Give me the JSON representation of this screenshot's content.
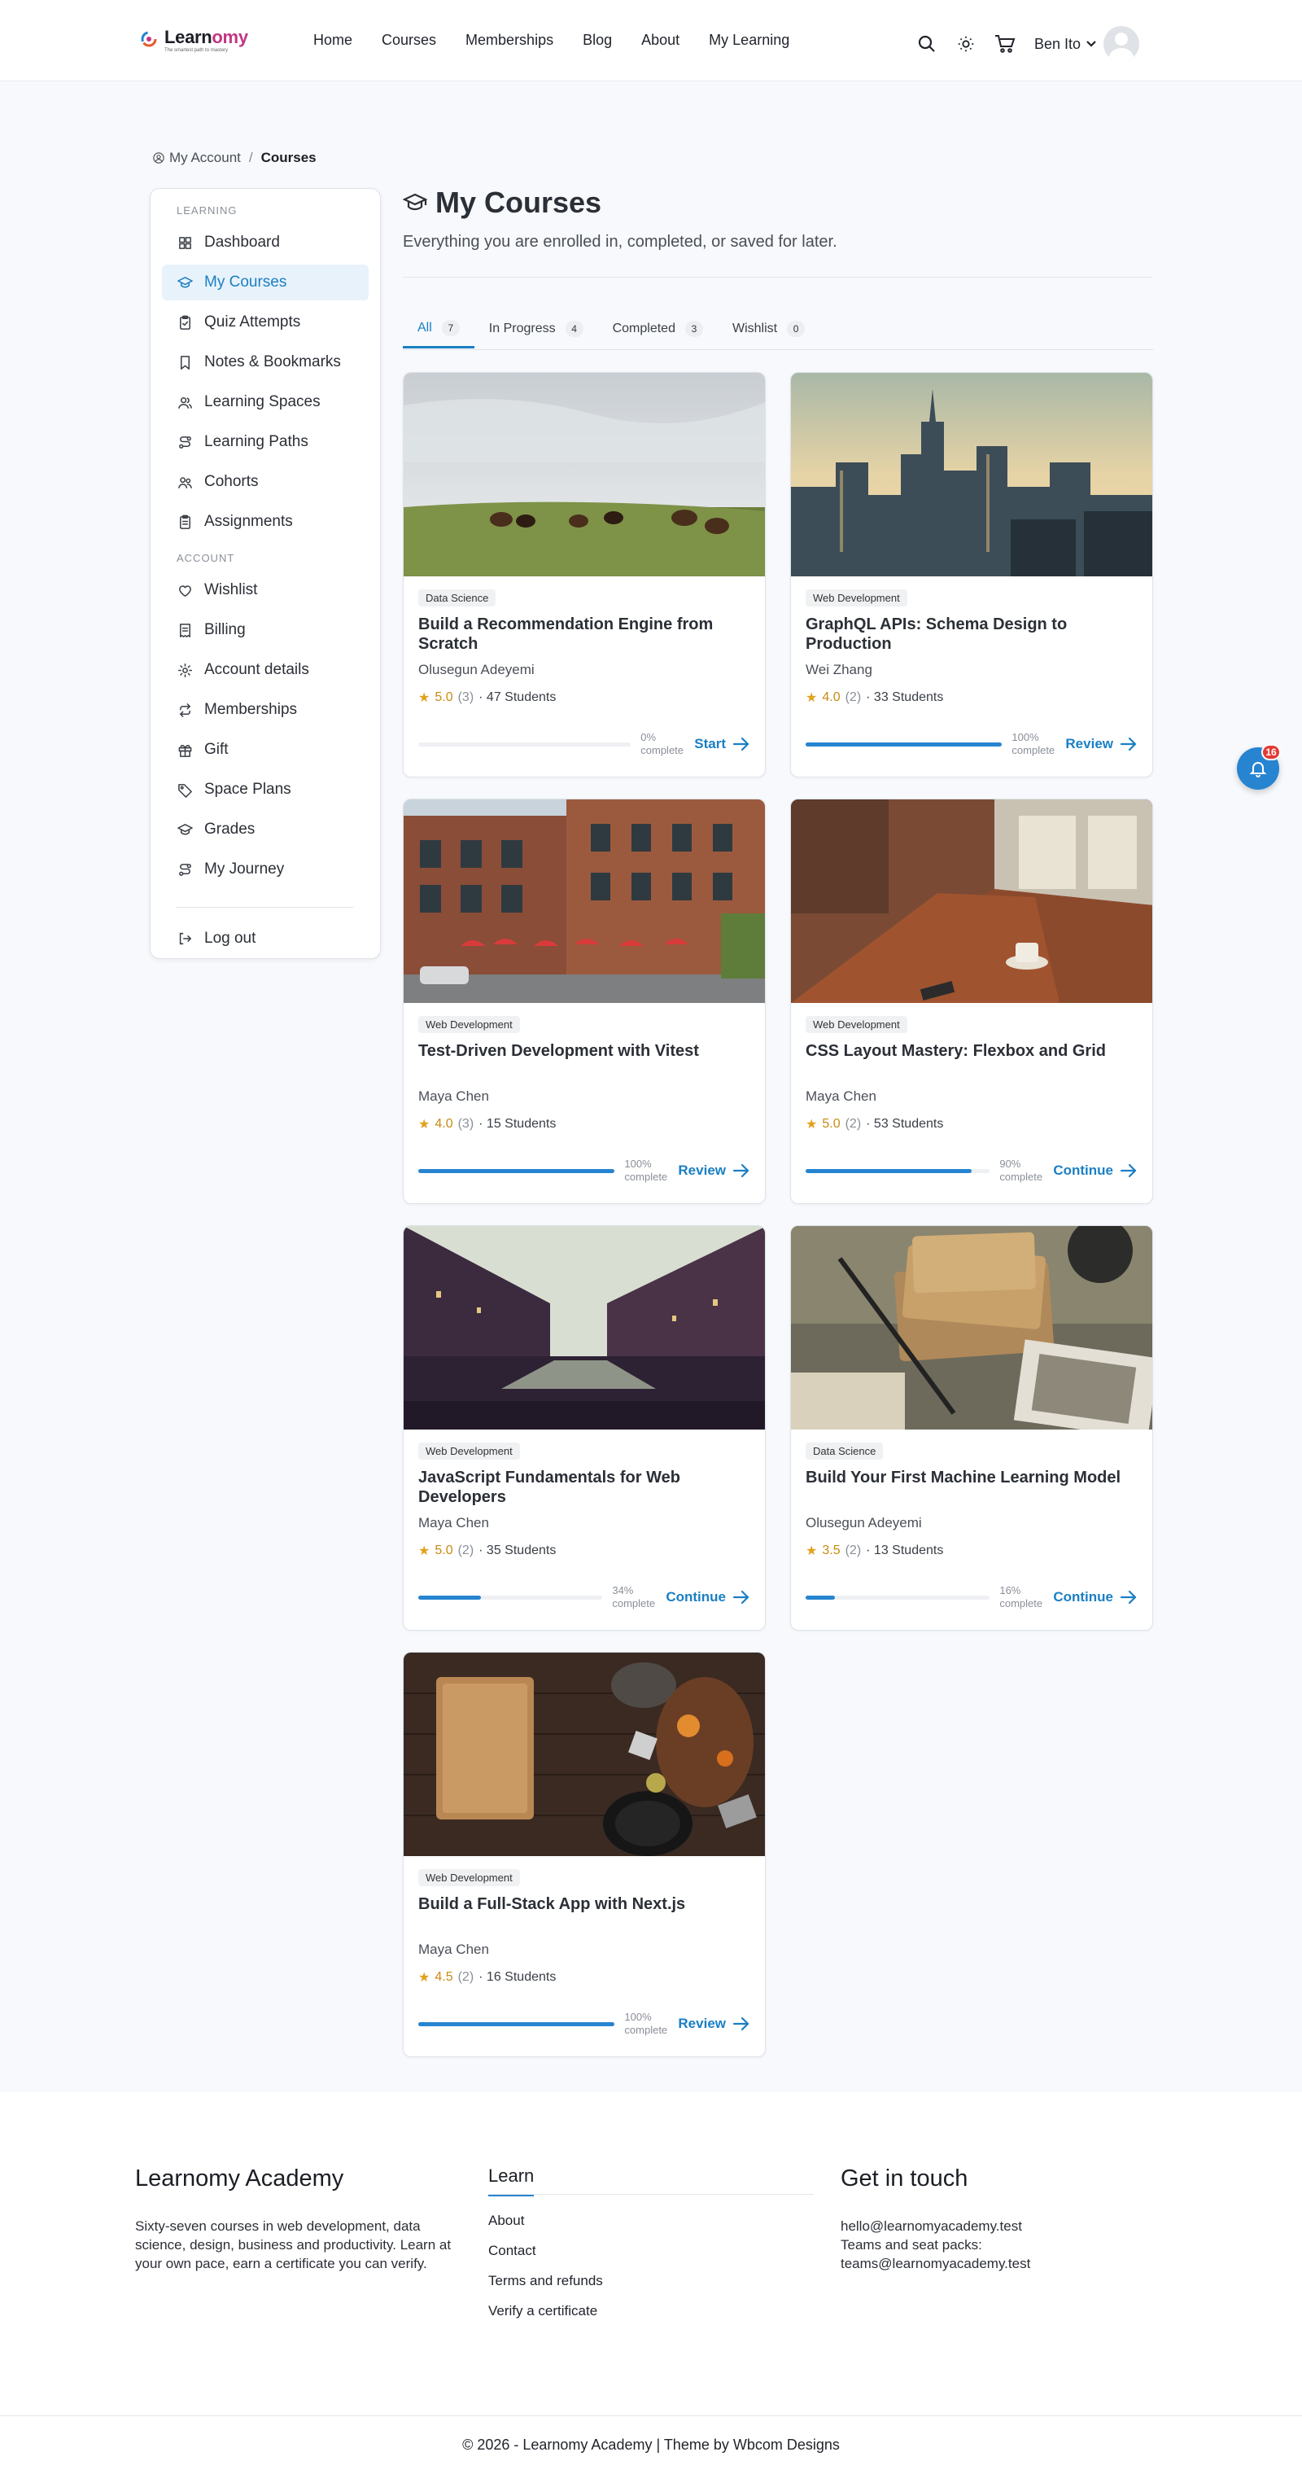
{
  "header": {
    "logo_text_main": "Learn",
    "logo_text_accent": "omy",
    "logo_tagline": "The smartest path to mastery",
    "nav": [
      "Home",
      "Courses",
      "Memberships",
      "Blog",
      "About",
      "My Learning"
    ],
    "user_name": "Ben Ito"
  },
  "breadcrumb": {
    "root": "My Account",
    "separator": "/",
    "current": "Courses"
  },
  "sidebar": {
    "learning_heading": "LEARNING",
    "learning_items": [
      {
        "label": "Dashboard",
        "icon": "dashboard-icon"
      },
      {
        "label": "My Courses",
        "icon": "graduation-cap-icon",
        "active": true
      },
      {
        "label": "Quiz Attempts",
        "icon": "clipboard-check-icon"
      },
      {
        "label": "Notes & Bookmarks",
        "icon": "bookmark-icon"
      },
      {
        "label": "Learning Spaces",
        "icon": "users-icon"
      },
      {
        "label": "Learning Paths",
        "icon": "route-icon"
      },
      {
        "label": "Cohorts",
        "icon": "group-icon"
      },
      {
        "label": "Assignments",
        "icon": "clipboard-list-icon"
      }
    ],
    "account_heading": "ACCOUNT",
    "account_items": [
      {
        "label": "Wishlist",
        "icon": "heart-icon"
      },
      {
        "label": "Billing",
        "icon": "receipt-icon"
      },
      {
        "label": "Account details",
        "icon": "gear-icon"
      },
      {
        "label": "Memberships",
        "icon": "repeat-icon"
      },
      {
        "label": "Gift",
        "icon": "gift-icon"
      },
      {
        "label": "Space Plans",
        "icon": "tag-icon"
      },
      {
        "label": "Grades",
        "icon": "graduation-cap-icon"
      },
      {
        "label": "My Journey",
        "icon": "route-icon"
      }
    ],
    "logout": "Log out"
  },
  "main": {
    "title": "My Courses",
    "subtitle": "Everything you are enrolled in, completed, or saved for later.",
    "tabs": [
      {
        "label": "All",
        "count": "7",
        "active": true
      },
      {
        "label": "In Progress",
        "count": "4"
      },
      {
        "label": "Completed",
        "count": "3"
      },
      {
        "label": "Wishlist",
        "count": "0"
      }
    ]
  },
  "progress_suffix": "complete",
  "courses": [
    {
      "category": "Data Science",
      "title": "Build a Recommendation Engine from Scratch",
      "author": "Olusegun Adeyemi",
      "score": "5.0",
      "reviews": "(3)",
      "students": "· 47 Students",
      "progress": 0,
      "pct": "0%",
      "action": "Start",
      "thumb": "horses"
    },
    {
      "category": "Web Development",
      "title": "GraphQL APIs: Schema Design to Production",
      "author": "Wei Zhang",
      "score": "4.0",
      "reviews": "(2)",
      "students": "· 33 Students",
      "progress": 100,
      "pct": "100%",
      "action": "Review",
      "thumb": "city"
    },
    {
      "category": "Web Development",
      "title": "Test-Driven Development with Vitest",
      "author": "Maya Chen",
      "score": "4.0",
      "reviews": "(3)",
      "students": "· 15 Students",
      "progress": 100,
      "pct": "100%",
      "action": "Review",
      "thumb": "street"
    },
    {
      "category": "Web Development",
      "title": "CSS Layout Mastery: Flexbox and Grid",
      "author": "Maya Chen",
      "score": "5.0",
      "reviews": "(2)",
      "students": "· 53 Students",
      "progress": 90,
      "pct": "90%",
      "action": "Continue",
      "thumb": "cafe"
    },
    {
      "category": "Web Development",
      "title": "JavaScript Fundamentals for Web Developers",
      "author": "Maya Chen",
      "score": "5.0",
      "reviews": "(2)",
      "students": "· 35 Students",
      "progress": 34,
      "pct": "34%",
      "action": "Continue",
      "thumb": "canal"
    },
    {
      "category": "Data Science",
      "title": "Build Your First Machine Learning Model",
      "author": "Olusegun Adeyemi",
      "score": "3.5",
      "reviews": "(2)",
      "students": "· 13 Students",
      "progress": 16,
      "pct": "16%",
      "action": "Continue",
      "thumb": "letters"
    },
    {
      "category": "Web Development",
      "title": "Build a Full-Stack App with Next.js",
      "author": "Maya Chen",
      "score": "4.5",
      "reviews": "(2)",
      "students": "· 16 Students",
      "progress": 100,
      "pct": "100%",
      "action": "Review",
      "thumb": "kitchen"
    }
  ],
  "notifications": {
    "count": "16"
  },
  "footer": {
    "brand_title": "Learnomy Academy",
    "brand_text": "Sixty-seven courses in web development, data science, design, business and productivity. Learn at your own pace, earn a certificate you can verify.",
    "learn_heading": "Learn",
    "learn_links": [
      "About",
      "Contact",
      "Terms and refunds",
      "Verify a certificate"
    ],
    "touch_heading": "Get in touch",
    "email": "hello@learnomyacademy.test",
    "teams_text": "Teams and seat packs:",
    "teams_email": "teams@learnomyacademy.test",
    "copyright": "© 2026 - Learnomy Academy | Theme by ",
    "theme_by": "Wbcom Designs"
  },
  "colors": {
    "accent": "#1a7fc4",
    "progress": "#2784d0",
    "star": "#e1a11b",
    "badge": "#e53935"
  }
}
